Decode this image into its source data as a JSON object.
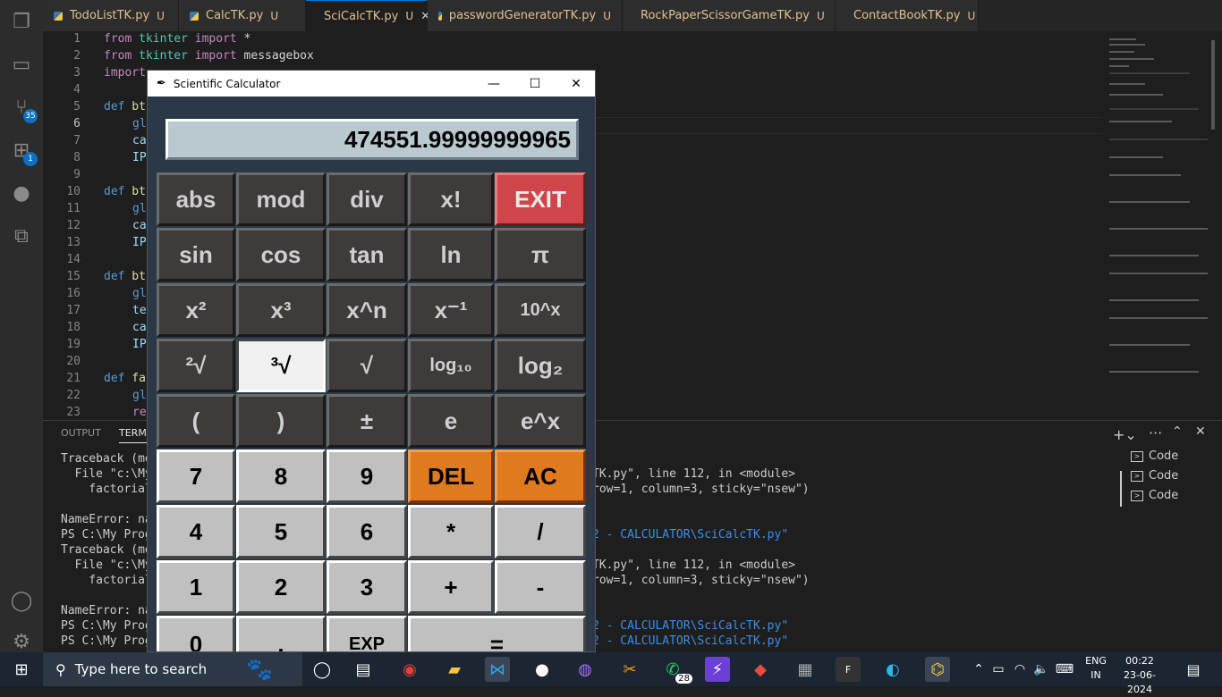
{
  "tabs": [
    {
      "name": "TodoListTK.py",
      "status": "U"
    },
    {
      "name": "CalcTK.py",
      "status": "U"
    },
    {
      "name": "SciCalcTK.py",
      "status": "U",
      "close": "✕"
    },
    {
      "name": "passwordGeneratorTK.py",
      "status": "U"
    },
    {
      "name": "RockPaperScissorGameTK.py",
      "status": "U"
    },
    {
      "name": "ContactBookTK.py",
      "status": "U"
    }
  ],
  "activity": {
    "scm_badge": "35",
    "ext_badge": "1"
  },
  "editor": {
    "lines": [
      "1",
      "2",
      "3",
      "4",
      "5",
      "6",
      "7",
      "8",
      "9",
      "10",
      "11",
      "12",
      "13",
      "14",
      "15",
      "16",
      "17",
      "18",
      "19",
      "20",
      "21",
      "22",
      "23"
    ],
    "line1_kw": "from",
    "line1_mod": "tkinter",
    "line1_imp": "import",
    "line1_rest": " *",
    "line2_kw": "from",
    "line2_mod": "tkinter",
    "line2_imp": "import",
    "line2_rest": " messagebox",
    "line3": "import",
    "line5_def": "def",
    "line5_rest": " bt",
    "line6": "gl",
    "line7": "ca",
    "line8": "IP",
    "line10_def": "def",
    "line10_rest": " bt",
    "line11": "gl",
    "line12": "ca",
    "line13": "IP",
    "line15_def": "def",
    "line15_rest": " bt",
    "line16": "gl",
    "line17": "te",
    "line18": "ca",
    "line19": "IP",
    "line21_def": "def",
    "line21_rest": " fa",
    "line22": "gl",
    "line23": "re"
  },
  "panel": {
    "tab_output": "OUTPUT",
    "tab_terminal": "TERMI",
    "terminal_left": [
      "Traceback (mos",
      "  File \"c:\\My",
      "    factorial_",
      "",
      "NameError: nam",
      "PS C:\\My Progr",
      "Traceback (mos",
      "  File \"c:\\My",
      "    factorial_",
      "",
      "NameError: nam",
      "PS C:\\My Progr",
      "PS C:\\My Progr"
    ],
    "terminal_right": {
      "r1": "TK.py\", line 112, in <module>",
      "r2": "row=1, column=3, sticky=\"nsew\")",
      "r3": "2 - CALCULATOR\\SciCalcTK.py\"",
      "r4": "TK.py\", line 112, in <module>",
      "r5": "row=1, column=3, sticky=\"nsew\")",
      "r6": "2 - CALCULATOR\\SciCalcTK.py\"",
      "r7": "2 - CALCULATOR\\SciCalcTK.py\""
    },
    "terminals": [
      "Code",
      "Code",
      "Code"
    ]
  },
  "calc": {
    "title": "Scientific Calculator",
    "display": "474551.99999999965",
    "keys": [
      [
        "abs",
        "mod",
        "div",
        "x!",
        "EXIT"
      ],
      [
        "sin",
        "cos",
        "tan",
        "ln",
        "π"
      ],
      [
        "x²",
        "x³",
        "x^n",
        "x⁻¹",
        "10^x"
      ],
      [
        "²√",
        "³√",
        "√",
        "log₁₀",
        "log₂"
      ],
      [
        "(",
        ")",
        "±",
        "e",
        "e^x"
      ],
      [
        "7",
        "8",
        "9",
        "DEL",
        "AC"
      ],
      [
        "4",
        "5",
        "6",
        "*",
        "/"
      ],
      [
        "1",
        "2",
        "3",
        "+",
        "-"
      ],
      [
        "0",
        ".",
        "EXP",
        "="
      ]
    ]
  },
  "taskbar": {
    "search_placeholder": "Type here to search",
    "whatsapp_badge": "28",
    "lang_top": "ENG",
    "lang_bottom": "IN",
    "time": "00:22",
    "date": "23-06-2024"
  }
}
